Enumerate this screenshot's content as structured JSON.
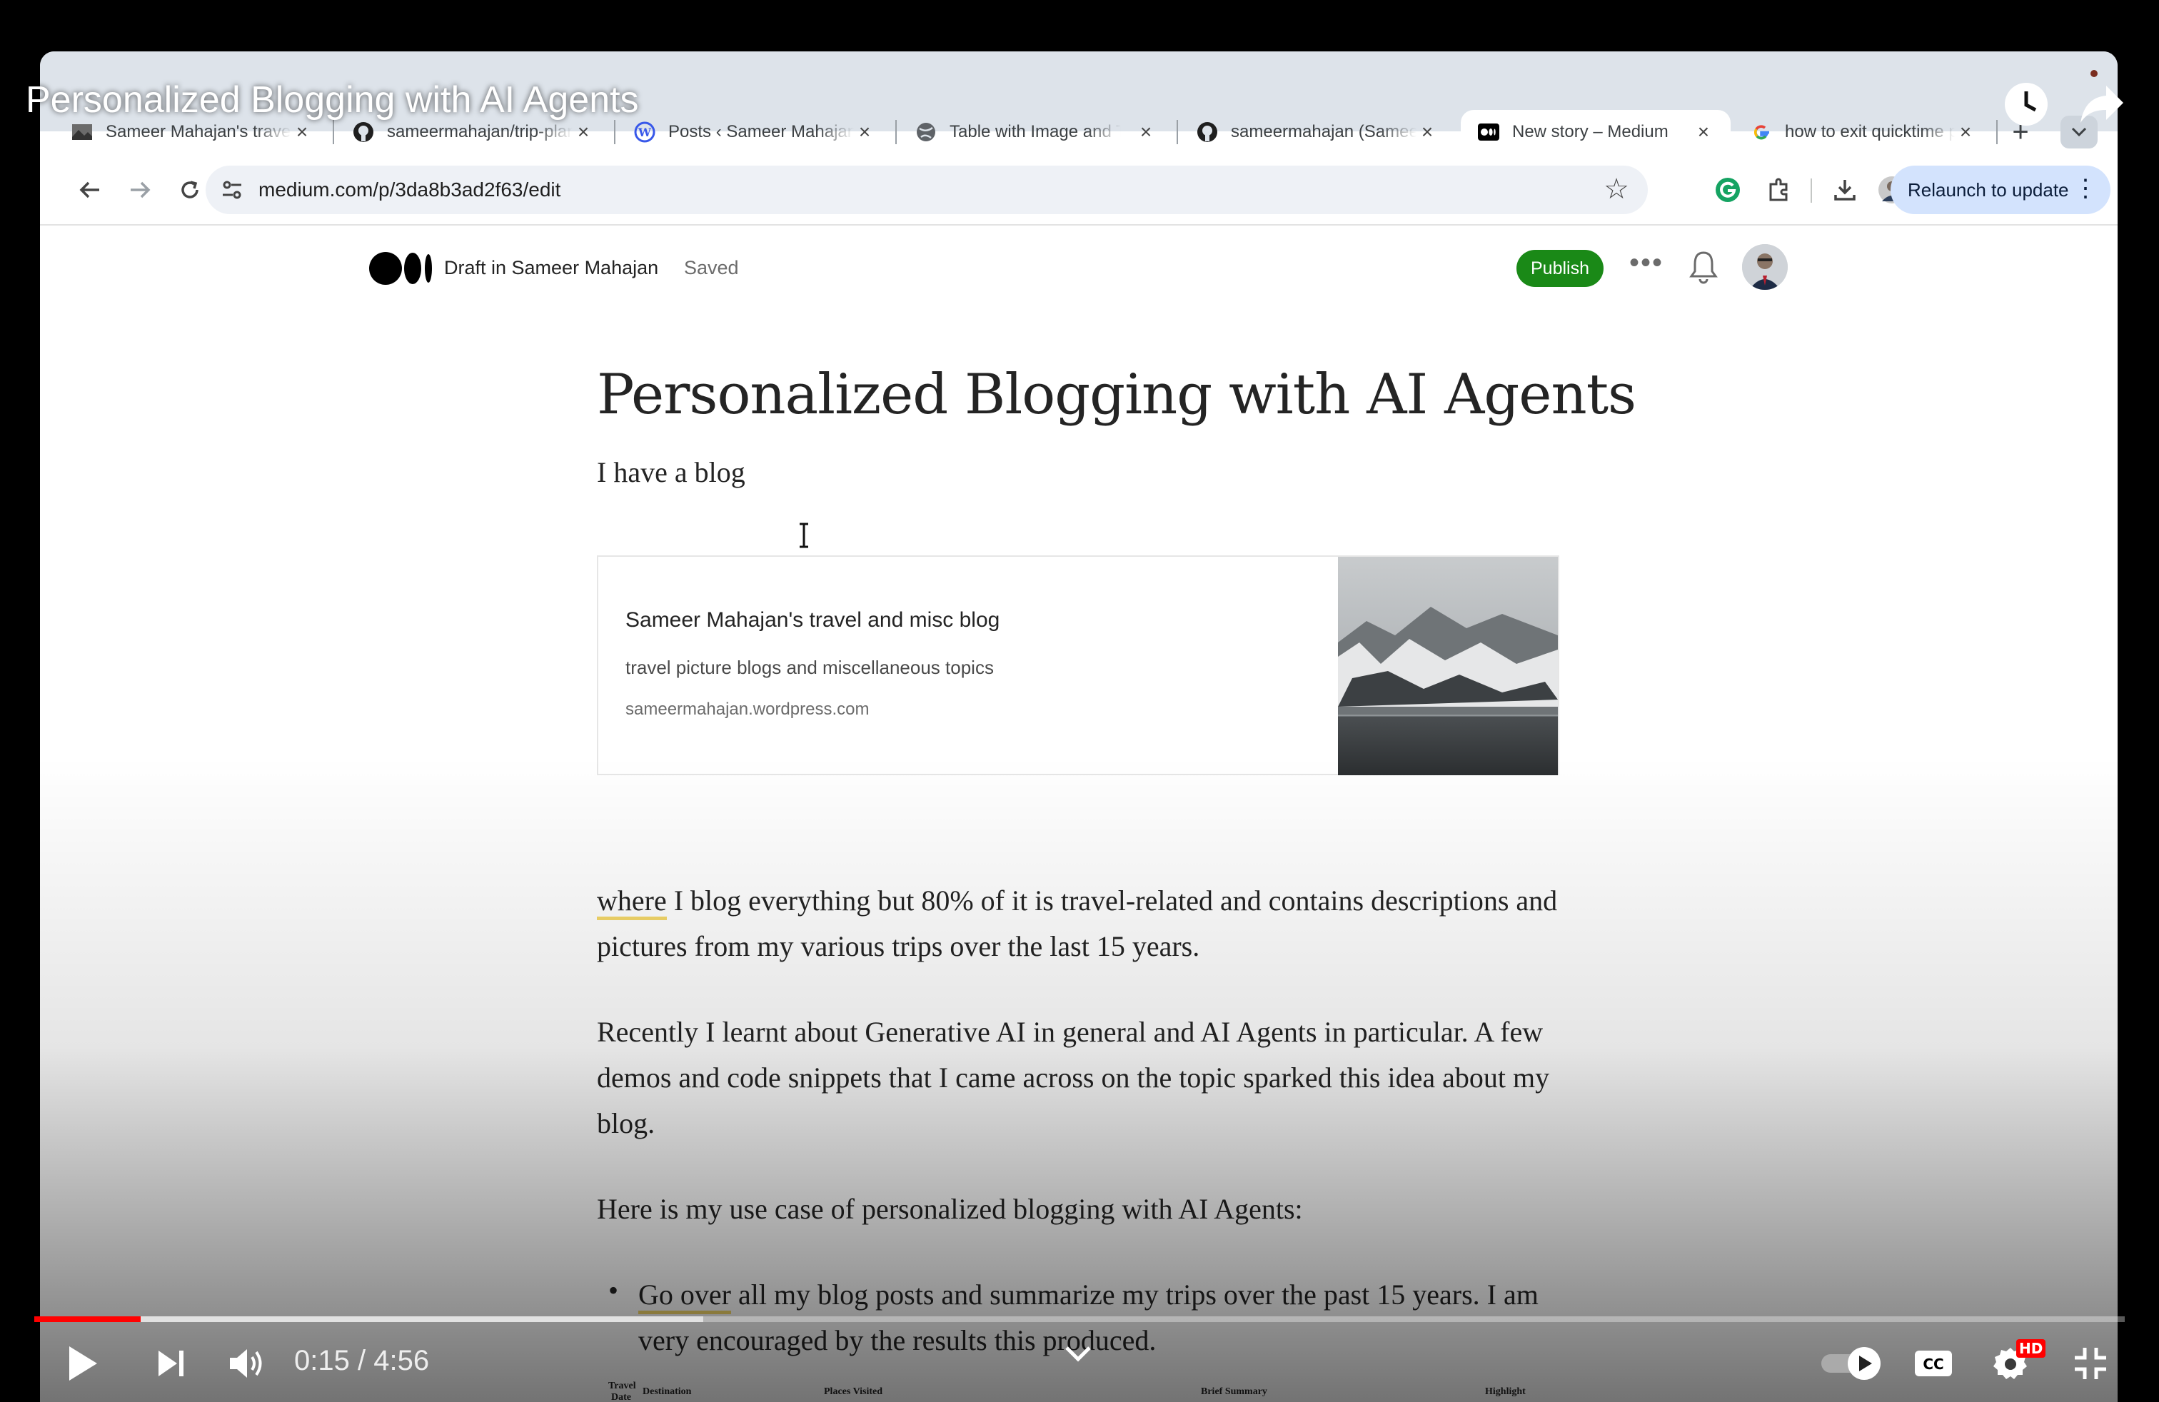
{
  "video": {
    "title": "Personalized Blogging with AI Agents",
    "time_current": "0:15",
    "time_separator": "/",
    "time_total": "4:56",
    "played_fraction": 0.051,
    "buffered_fraction": 0.32,
    "hd_badge": "HD",
    "accent_color": "#ff0000"
  },
  "browser": {
    "tabs": [
      {
        "label": "Sameer Mahajan's travel and misc blog",
        "icon": "photo-favicon"
      },
      {
        "label": "sameermahajan/trip-planner",
        "icon": "github-icon"
      },
      {
        "label": "Posts ‹ Sameer Mahajan's travel",
        "icon": "wordpress-icon"
      },
      {
        "label": "Table with Image and Text",
        "icon": "globe-icon"
      },
      {
        "label": "sameermahajan (Sameer Mahajan)",
        "icon": "github-icon"
      },
      {
        "label": "New story – Medium",
        "icon": "medium-icon",
        "active": true
      },
      {
        "label": "how to exit quicktime player",
        "icon": "google-icon"
      }
    ],
    "new_tab": "+",
    "url": "medium.com/p/3da8b3ad2f63/edit",
    "relaunch_label": "Relaunch to update"
  },
  "medium": {
    "draft_label": "Draft in Sameer Mahajan",
    "saved_label": "Saved",
    "publish_label": "Publish",
    "publish_color": "#1a8917",
    "article": {
      "title": "Personalized Blogging with AI Agents",
      "subtitle": "I have a blog",
      "embed": {
        "title": "Sameer Mahajan's travel and misc blog",
        "description": "travel picture blogs and miscellaneous topics",
        "domain": "sameermahajan.wordpress.com"
      },
      "p1_highlight": "where",
      "p1_rest": " I blog everything but 80% of it is travel-related and contains descriptions and pictures from my various trips over the last 15 years.",
      "p2": "Recently I learnt about Generative AI in general and AI Agents in particular. A few demos and code snippets that I came across on the topic sparked this idea about my blog.",
      "p3": "Here is my use case of personalized blogging with AI Agents:",
      "bullet1_highlight": "Go over",
      "bullet1_rest": " all my blog posts and summarize my trips over the past 15 years. I am very encouraged by the results this produced."
    }
  },
  "table_hint": {
    "travel": "Travel",
    "date": "Date",
    "destination": "Destination",
    "places_visited": "Places Visited",
    "brief_summary": "Brief Summary",
    "highlight": "Highlight"
  }
}
